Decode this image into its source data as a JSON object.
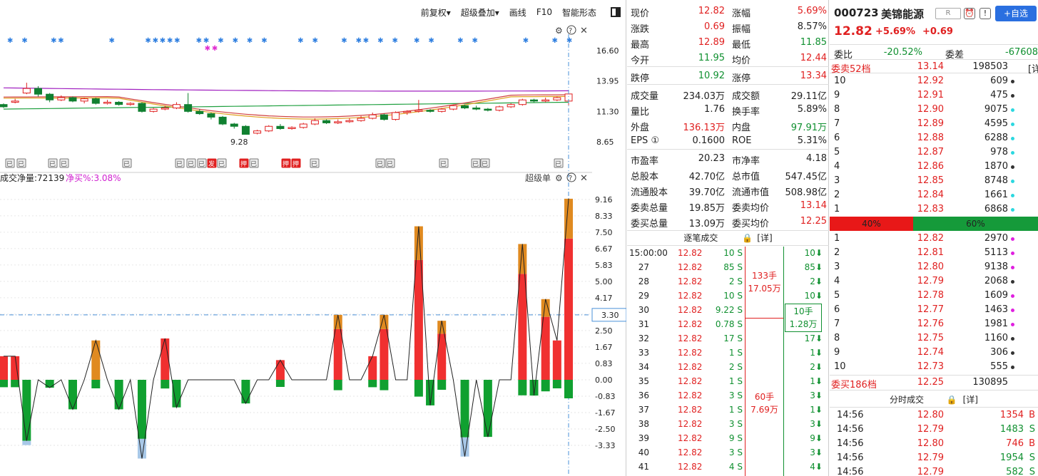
{
  "toolbar": {
    "items": [
      "前复权▾",
      "超级叠加▾",
      "画线",
      "F10",
      "智能形态"
    ]
  },
  "kline": {
    "price_labels": [
      "16.60",
      "13.95",
      "11.30",
      "8.65"
    ],
    "low_label": "9.28",
    "candles": [
      {
        "o": 11.9,
        "c": 11.7,
        "h": 12.0,
        "l": 11.6
      },
      {
        "o": 12.1,
        "c": 12.2,
        "h": 12.4,
        "l": 12.0
      },
      {
        "o": 12.9,
        "c": 13.3,
        "h": 13.8,
        "l": 12.8
      },
      {
        "o": 13.3,
        "c": 12.8,
        "h": 13.5,
        "l": 12.6
      },
      {
        "o": 12.8,
        "c": 12.3,
        "h": 12.9,
        "l": 12.1
      },
      {
        "o": 12.3,
        "c": 12.5,
        "h": 12.7,
        "l": 12.2
      },
      {
        "o": 12.5,
        "c": 12.2,
        "h": 12.6,
        "l": 12.1
      },
      {
        "o": 12.2,
        "c": 12.4,
        "h": 12.5,
        "l": 12.0
      },
      {
        "o": 12.4,
        "c": 12.0,
        "h": 12.5,
        "l": 11.9
      },
      {
        "o": 12.0,
        "c": 12.1,
        "h": 12.3,
        "l": 11.9
      },
      {
        "o": 12.1,
        "c": 11.9,
        "h": 12.2,
        "l": 11.8
      },
      {
        "o": 11.9,
        "c": 12.0,
        "h": 12.1,
        "l": 11.8
      },
      {
        "o": 12.0,
        "c": 11.3,
        "h": 12.1,
        "l": 11.2
      },
      {
        "o": 11.3,
        "c": 11.5,
        "h": 11.6,
        "l": 11.2
      },
      {
        "o": 11.5,
        "c": 11.6,
        "h": 11.8,
        "l": 11.4
      },
      {
        "o": 11.6,
        "c": 11.9,
        "h": 12.1,
        "l": 11.5
      },
      {
        "o": 11.9,
        "c": 11.3,
        "h": 12.9,
        "l": 11.2
      },
      {
        "o": 11.3,
        "c": 11.1,
        "h": 11.5,
        "l": 11.0
      },
      {
        "o": 11.1,
        "c": 10.8,
        "h": 11.2,
        "l": 10.6
      },
      {
        "o": 10.8,
        "c": 10.2,
        "h": 10.9,
        "l": 10.1
      },
      {
        "o": 10.2,
        "c": 10.0,
        "h": 10.3,
        "l": 9.8
      },
      {
        "o": 10.0,
        "c": 9.3,
        "h": 10.1,
        "l": 9.28
      },
      {
        "o": 9.4,
        "c": 9.6,
        "h": 9.7,
        "l": 9.3
      },
      {
        "o": 9.6,
        "c": 10.0,
        "h": 10.1,
        "l": 9.5
      },
      {
        "o": 10.0,
        "c": 9.8,
        "h": 10.2,
        "l": 9.7
      },
      {
        "o": 9.8,
        "c": 9.9,
        "h": 10.0,
        "l": 9.7
      },
      {
        "o": 9.9,
        "c": 10.2,
        "h": 10.3,
        "l": 9.8
      },
      {
        "o": 10.2,
        "c": 10.5,
        "h": 10.7,
        "l": 10.1
      },
      {
        "o": 10.5,
        "c": 10.3,
        "h": 10.6,
        "l": 10.2
      },
      {
        "o": 10.3,
        "c": 10.4,
        "h": 10.6,
        "l": 10.2
      },
      {
        "o": 10.4,
        "c": 10.5,
        "h": 10.7,
        "l": 10.3
      },
      {
        "o": 10.5,
        "c": 10.7,
        "h": 10.9,
        "l": 10.4
      },
      {
        "o": 10.7,
        "c": 11.0,
        "h": 11.2,
        "l": 10.6
      },
      {
        "o": 11.0,
        "c": 10.6,
        "h": 11.1,
        "l": 10.5
      },
      {
        "o": 10.6,
        "c": 11.2,
        "h": 11.3,
        "l": 10.5
      },
      {
        "o": 11.2,
        "c": 11.3,
        "h": 11.4,
        "l": 11.0
      },
      {
        "o": 11.3,
        "c": 11.4,
        "h": 12.3,
        "l": 11.2
      },
      {
        "o": 11.4,
        "c": 11.3,
        "h": 11.5,
        "l": 11.2
      },
      {
        "o": 11.3,
        "c": 11.5,
        "h": 11.6,
        "l": 11.2
      },
      {
        "o": 11.5,
        "c": 11.8,
        "h": 11.9,
        "l": 11.4
      },
      {
        "o": 11.8,
        "c": 11.6,
        "h": 11.9,
        "l": 11.5
      },
      {
        "o": 11.6,
        "c": 11.5,
        "h": 11.8,
        "l": 11.4
      },
      {
        "o": 11.5,
        "c": 11.4,
        "h": 11.6,
        "l": 11.3
      },
      {
        "o": 11.4,
        "c": 11.7,
        "h": 11.8,
        "l": 11.3
      },
      {
        "o": 11.7,
        "c": 11.9,
        "h": 12.0,
        "l": 11.6
      },
      {
        "o": 11.9,
        "c": 12.3,
        "h": 12.4,
        "l": 11.8
      },
      {
        "o": 12.3,
        "c": 12.2,
        "h": 12.4,
        "l": 12.1
      },
      {
        "o": 12.2,
        "c": 12.3,
        "h": 12.5,
        "l": 12.1
      },
      {
        "o": 12.3,
        "c": 12.5,
        "h": 12.6,
        "l": 12.2
      },
      {
        "o": 12.2,
        "c": 12.82,
        "h": 12.89,
        "l": 11.85
      }
    ],
    "star_rows": "blue and pink event markers",
    "event_tags": [
      "已",
      "已",
      "已",
      "已",
      "已",
      "已",
      "已",
      "已",
      "发",
      "已",
      "押",
      "已",
      "押",
      "押",
      "已",
      "已",
      "已",
      "已",
      "已",
      "已",
      "已"
    ]
  },
  "flow": {
    "header": "成交净量:72139",
    "header_pct": "净买%:3.08%",
    "corner_label": "超级单",
    "axis_labels": [
      "9.16",
      "8.33",
      "7.50",
      "6.67",
      "5.83",
      "5.00",
      "4.17",
      "2.50",
      "1.67",
      "0.83",
      "0.00",
      "-0.83",
      "-1.67",
      "-2.50",
      "-3.33"
    ],
    "crosshair_value": "3.30",
    "values": [
      1.2,
      1.2,
      -3.1,
      0.0,
      -0.4,
      0.0,
      -1.5,
      0.0,
      2.0,
      0.0,
      -1.5,
      0.0,
      -4.0,
      0.0,
      2.1,
      -1.4,
      0.0,
      0.0,
      0.0,
      0.0,
      0.0,
      -1.2,
      0.0,
      0.0,
      1.0,
      0.0,
      0.0,
      0.0,
      0.0,
      3.3,
      0.0,
      0.0,
      1.2,
      3.3,
      0.0,
      0.0,
      7.8,
      -1.3,
      3.0,
      0.0,
      -3.9,
      0.0,
      -2.9,
      0.0,
      0.0,
      6.9,
      -0.8,
      4.1,
      2.0,
      9.2
    ]
  },
  "quote": {
    "rows": [
      [
        {
          "l": "现价",
          "v": "12.82",
          "c": "red"
        },
        {
          "l": "涨幅",
          "v": "5.69%",
          "c": "red"
        }
      ],
      [
        {
          "l": "涨跌",
          "v": "0.69",
          "c": "red"
        },
        {
          "l": "振幅",
          "v": "8.57%",
          "c": "black"
        }
      ],
      [
        {
          "l": "最高",
          "v": "12.89",
          "c": "red"
        },
        {
          "l": "最低",
          "v": "11.85",
          "c": "green"
        }
      ],
      [
        {
          "l": "今开",
          "v": "11.95",
          "c": "green"
        },
        {
          "l": "均价",
          "v": "12.44",
          "c": "red"
        }
      ],
      [
        {
          "l": "跌停",
          "v": "10.92",
          "c": "green"
        },
        {
          "l": "涨停",
          "v": "13.34",
          "c": "red"
        }
      ],
      [
        {
          "l": "成交量",
          "v": "234.03万",
          "c": "black"
        },
        {
          "l": "成交额",
          "v": "29.11亿",
          "c": "black"
        }
      ],
      [
        {
          "l": "量比",
          "v": "1.76",
          "c": "black"
        },
        {
          "l": "换手率",
          "v": "5.89%",
          "c": "black"
        }
      ],
      [
        {
          "l": "外盘",
          "v": "136.13万",
          "c": "red"
        },
        {
          "l": "内盘",
          "v": "97.91万",
          "c": "green"
        }
      ],
      [
        {
          "l": "EPS ①",
          "v": "0.1600",
          "c": "black"
        },
        {
          "l": "ROE",
          "v": "5.31%",
          "c": "black"
        }
      ],
      [
        {
          "l": "市盈率",
          "v": "20.23",
          "c": "black"
        },
        {
          "l": "市净率",
          "v": "4.18",
          "c": "black"
        }
      ],
      [
        {
          "l": "总股本",
          "v": "42.70亿",
          "c": "black"
        },
        {
          "l": "总市值",
          "v": "547.45亿",
          "c": "black"
        }
      ],
      [
        {
          "l": "流通股本",
          "v": "39.70亿",
          "c": "black"
        },
        {
          "l": "流通市值",
          "v": "508.98亿",
          "c": "black"
        }
      ],
      [
        {
          "l": "委卖总量",
          "v": "19.85万",
          "c": "black"
        },
        {
          "l": "委卖均价",
          "v": "13.14",
          "c": "red"
        }
      ],
      [
        {
          "l": "委买总量",
          "v": "13.09万",
          "c": "black"
        },
        {
          "l": "委买均价",
          "v": "12.25",
          "c": "red"
        }
      ]
    ],
    "tick_title": "逐笔成交",
    "tick_detail": "[详]",
    "ticks": [
      {
        "t": "15:00:00",
        "p": "12.82",
        "v": "10 S"
      },
      {
        "t": "27",
        "p": "12.82",
        "v": "85 S"
      },
      {
        "t": "28",
        "p": "12.82",
        "v": "2 S"
      },
      {
        "t": "29",
        "p": "12.82",
        "v": "10 S"
      },
      {
        "t": "30",
        "p": "12.82",
        "v": "9.22 S"
      },
      {
        "t": "31",
        "p": "12.82",
        "v": "0.78 S"
      },
      {
        "t": "32",
        "p": "12.82",
        "v": "17 S"
      },
      {
        "t": "33",
        "p": "12.82",
        "v": "1 S"
      },
      {
        "t": "34",
        "p": "12.82",
        "v": "2 S"
      },
      {
        "t": "35",
        "p": "12.82",
        "v": "1 S"
      },
      {
        "t": "36",
        "p": "12.82",
        "v": "3 S"
      },
      {
        "t": "37",
        "p": "12.82",
        "v": "1 S"
      },
      {
        "t": "38",
        "p": "12.82",
        "v": "3 S"
      },
      {
        "t": "39",
        "p": "12.82",
        "v": "9 S"
      },
      {
        "t": "40",
        "p": "12.82",
        "v": "3 S"
      },
      {
        "t": "41",
        "p": "12.82",
        "v": "4 S"
      }
    ],
    "groups": [
      {
        "a": "133手",
        "b": "17.05万"
      },
      {
        "a": "60手",
        "b": "7.69万"
      }
    ],
    "boxed": {
      "a": "10手",
      "b": "1.28万"
    },
    "right_ticks": [
      "10⬇",
      "85⬇",
      "2⬇",
      "10⬇",
      "",
      "",
      "17⬇",
      "1⬇",
      "2⬇",
      "1⬇",
      "3⬇",
      "1⬇",
      "3⬇",
      "9⬇",
      "3⬇",
      "4⬇"
    ]
  },
  "stock": {
    "code": "000723",
    "name": "美锦能源",
    "r_badge": "R",
    "add_label": "+自选",
    "price": "12.82",
    "pct": "+5.69%",
    "chg": "+0.69"
  },
  "book": {
    "wb_label": "委比",
    "wb_value": "-20.52%",
    "wc_label": "委差",
    "wc_value": "-67608",
    "sell_summary": {
      "label": "委卖52档",
      "price": "13.14",
      "vol": "198503",
      "detail": "[详"
    },
    "asks": [
      {
        "n": "10",
        "p": "12.92",
        "v": "609",
        "d": "#333"
      },
      {
        "n": "9",
        "p": "12.91",
        "v": "475",
        "d": "#333"
      },
      {
        "n": "8",
        "p": "12.90",
        "v": "9075",
        "d": "#2cd8e0"
      },
      {
        "n": "7",
        "p": "12.89",
        "v": "4595",
        "d": "#2cd8e0"
      },
      {
        "n": "6",
        "p": "12.88",
        "v": "6288",
        "d": "#2cd8e0"
      },
      {
        "n": "5",
        "p": "12.87",
        "v": "978",
        "d": "#2cd8e0"
      },
      {
        "n": "4",
        "p": "12.86",
        "v": "1870",
        "d": "#333"
      },
      {
        "n": "3",
        "p": "12.85",
        "v": "8748",
        "d": "#2cd8e0"
      },
      {
        "n": "2",
        "p": "12.84",
        "v": "1661",
        "d": "#2cd8e0"
      },
      {
        "n": "1",
        "p": "12.83",
        "v": "6868",
        "d": "#2cd8e0"
      }
    ],
    "ratio_left": "40%",
    "ratio_right": "60%",
    "ratio_left_fraction": 0.4,
    "bids": [
      {
        "n": "1",
        "p": "12.82",
        "v": "2970",
        "d": "#e020e0"
      },
      {
        "n": "2",
        "p": "12.81",
        "v": "5113",
        "d": "#e020e0"
      },
      {
        "n": "3",
        "p": "12.80",
        "v": "9138",
        "d": "#e020e0"
      },
      {
        "n": "4",
        "p": "12.79",
        "v": "2068",
        "d": "#333"
      },
      {
        "n": "5",
        "p": "12.78",
        "v": "1609",
        "d": "#e020e0"
      },
      {
        "n": "6",
        "p": "12.77",
        "v": "1463",
        "d": "#e020e0"
      },
      {
        "n": "7",
        "p": "12.76",
        "v": "1981",
        "d": "#e020e0"
      },
      {
        "n": "8",
        "p": "12.75",
        "v": "1160",
        "d": "#333"
      },
      {
        "n": "9",
        "p": "12.74",
        "v": "306",
        "d": "#333"
      },
      {
        "n": "10",
        "p": "12.73",
        "v": "555",
        "d": "#333"
      }
    ],
    "buy_summary": {
      "label": "委买186档",
      "price": "12.25",
      "vol": "130895"
    },
    "minute_title": "分时成交",
    "minute_detail": "[详]",
    "minute_trades": [
      {
        "t": "14:56",
        "p": "12.80",
        "v": "1354",
        "s": "B"
      },
      {
        "t": "14:56",
        "p": "12.79",
        "v": "1483",
        "s": "S"
      },
      {
        "t": "14:56",
        "p": "12.80",
        "v": "746",
        "s": "B"
      },
      {
        "t": "14:56",
        "p": "12.79",
        "v": "1954",
        "s": "S"
      },
      {
        "t": "14:56",
        "p": "12.79",
        "v": "582",
        "s": "S"
      }
    ]
  }
}
